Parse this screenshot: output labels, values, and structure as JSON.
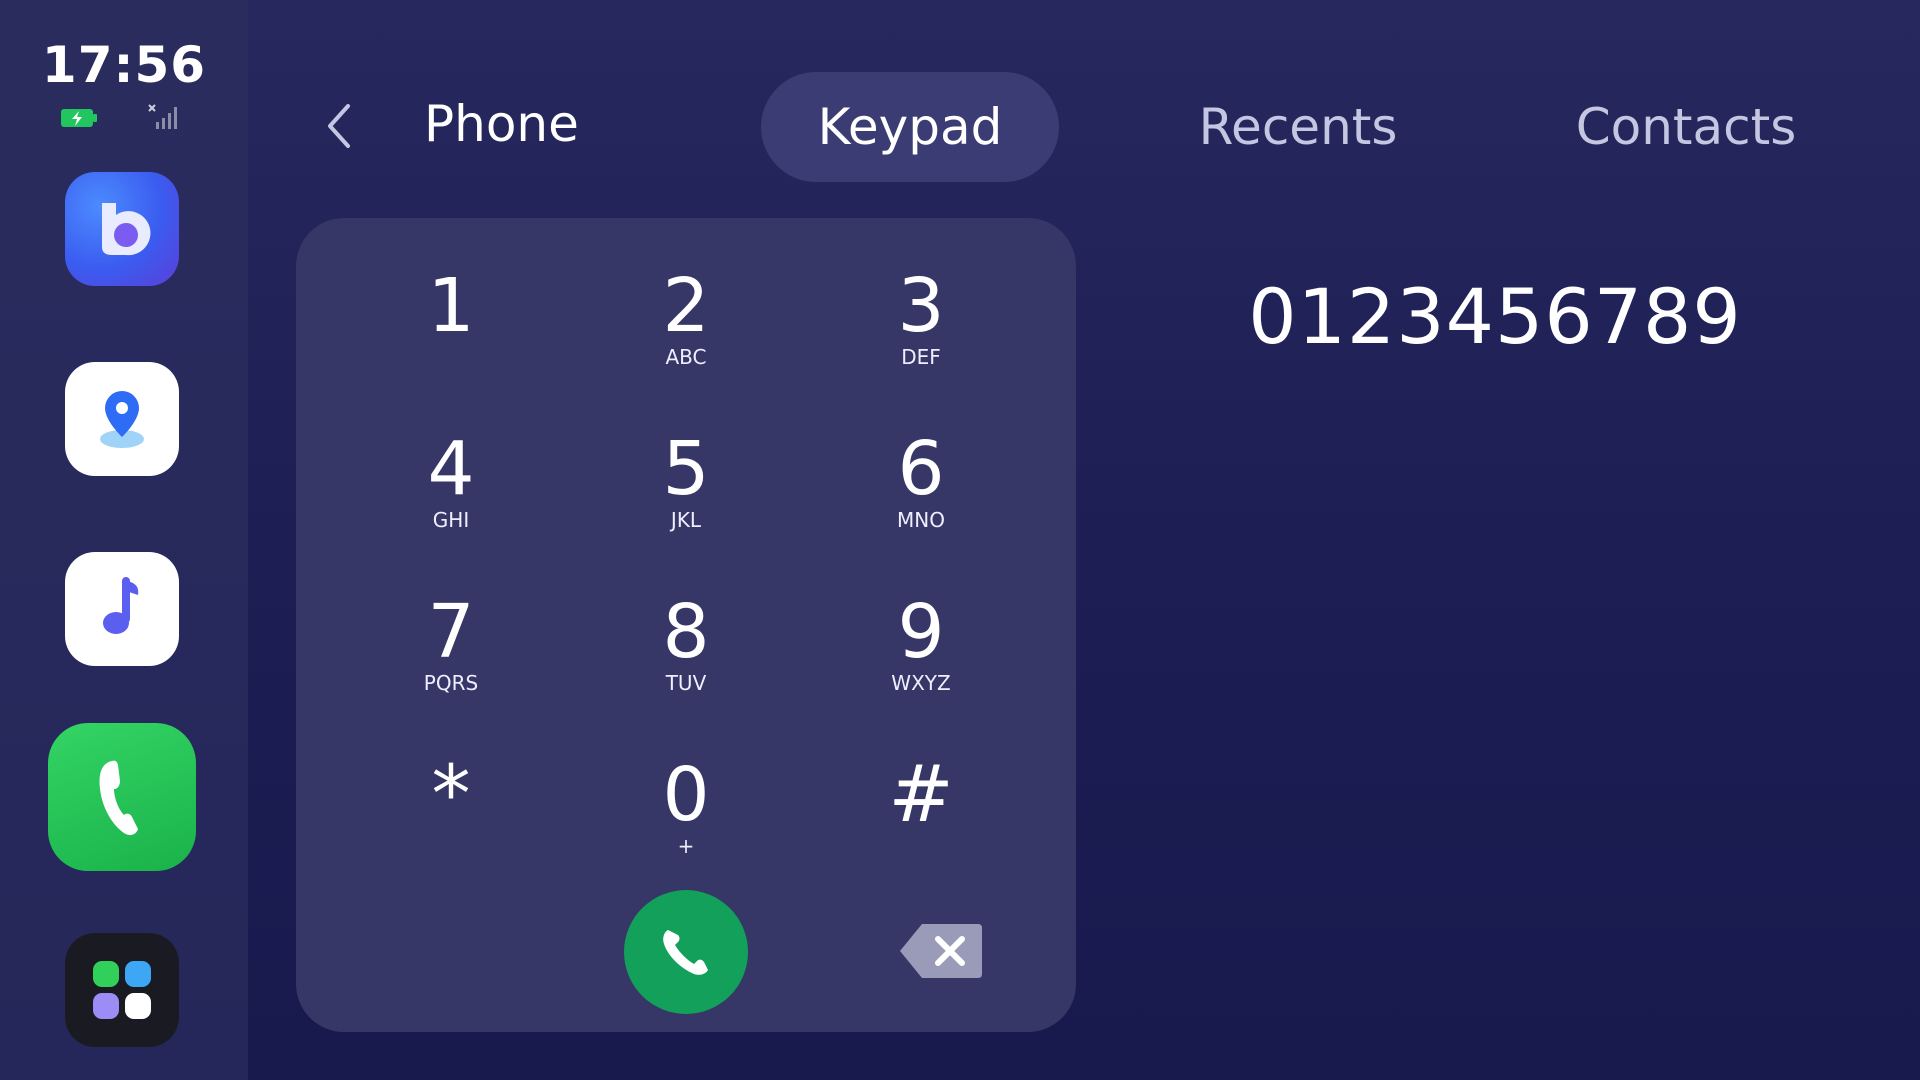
{
  "status": {
    "time": "17:56"
  },
  "dock": {
    "apps": [
      {
        "name": "bixby-app"
      },
      {
        "name": "maps-app"
      },
      {
        "name": "music-app"
      },
      {
        "name": "phone-app"
      },
      {
        "name": "app-launcher"
      }
    ]
  },
  "header": {
    "title": "Phone",
    "tabs": [
      {
        "label": "Keypad",
        "active": true
      },
      {
        "label": "Recents",
        "active": false
      },
      {
        "label": "Contacts",
        "active": false
      }
    ]
  },
  "keypad": {
    "keys": [
      {
        "digit": "1",
        "letters": ""
      },
      {
        "digit": "2",
        "letters": "ABC"
      },
      {
        "digit": "3",
        "letters": "DEF"
      },
      {
        "digit": "4",
        "letters": "GHI"
      },
      {
        "digit": "5",
        "letters": "JKL"
      },
      {
        "digit": "6",
        "letters": "MNO"
      },
      {
        "digit": "7",
        "letters": "PQRS"
      },
      {
        "digit": "8",
        "letters": "TUV"
      },
      {
        "digit": "9",
        "letters": "WXYZ"
      },
      {
        "digit": "*",
        "letters": ""
      },
      {
        "digit": "0",
        "letters": "+"
      },
      {
        "digit": "#",
        "letters": ""
      }
    ]
  },
  "dialed_number": "0123456789",
  "colors": {
    "background": "#1d1f55",
    "dock": "#27295c",
    "keypad_panel": "#363767",
    "active_tab": "#3b3c74",
    "call_button": "#12a05a"
  }
}
